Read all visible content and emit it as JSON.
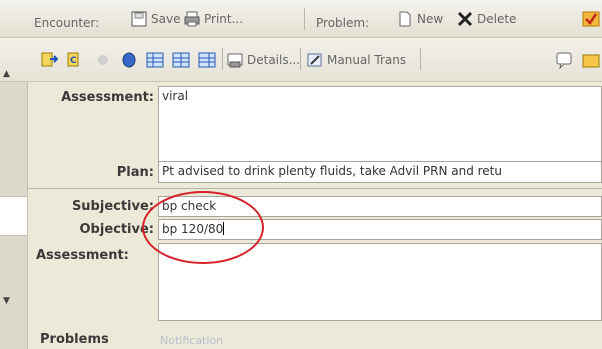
{
  "toolbar": {
    "encounter_label": "Encounter:",
    "save_label": "Save",
    "print_label": "Print...",
    "problem_label": "Problem:",
    "new_label": "New",
    "delete_label": "Delete",
    "details_label": "Details...",
    "manual_trans_label": "Manual Trans"
  },
  "upper": {
    "assessment_label": "Assessment:",
    "assessment_value": "viral",
    "plan_label": "Plan:",
    "plan_value": "Pt advised to drink plenty fluids, take Advil PRN and retu"
  },
  "lower": {
    "subjective_label": "Subjective:",
    "subjective_value": "bp check",
    "objective_label": "Objective:",
    "objective_value": "bp 120/80",
    "assessment_label": "Assessment:",
    "assessment_value": ""
  },
  "footer": {
    "problems_label": "Problems",
    "faded_text": "Notification"
  },
  "colors": {
    "annotation_circle": "#d6212a",
    "toolbar_bg": "#ece9d8"
  }
}
